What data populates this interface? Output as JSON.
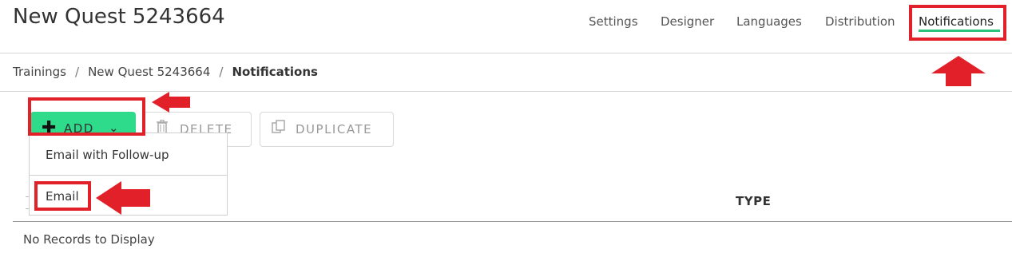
{
  "header": {
    "title": "New Quest 5243664",
    "tabs": [
      {
        "label": "Settings"
      },
      {
        "label": "Designer"
      },
      {
        "label": "Languages"
      },
      {
        "label": "Distribution"
      },
      {
        "label": "Notifications"
      }
    ],
    "active_tab": "Notifications"
  },
  "breadcrumb": {
    "items": [
      "Trainings",
      "New Quest 5243664",
      "Notifications"
    ],
    "separator": "/"
  },
  "toolbar": {
    "add_label": "ADD",
    "delete_label": "DELETE",
    "duplicate_label": "DUPLICATE"
  },
  "add_menu": {
    "items": [
      "Email with Follow-up",
      "Email"
    ]
  },
  "table": {
    "columns": [
      "TYPE"
    ],
    "empty_text": "No Records to Display"
  },
  "colors": {
    "accent": "#2edb8a",
    "tab_underline": "#2bc47d",
    "annotation": "#e2202a"
  }
}
